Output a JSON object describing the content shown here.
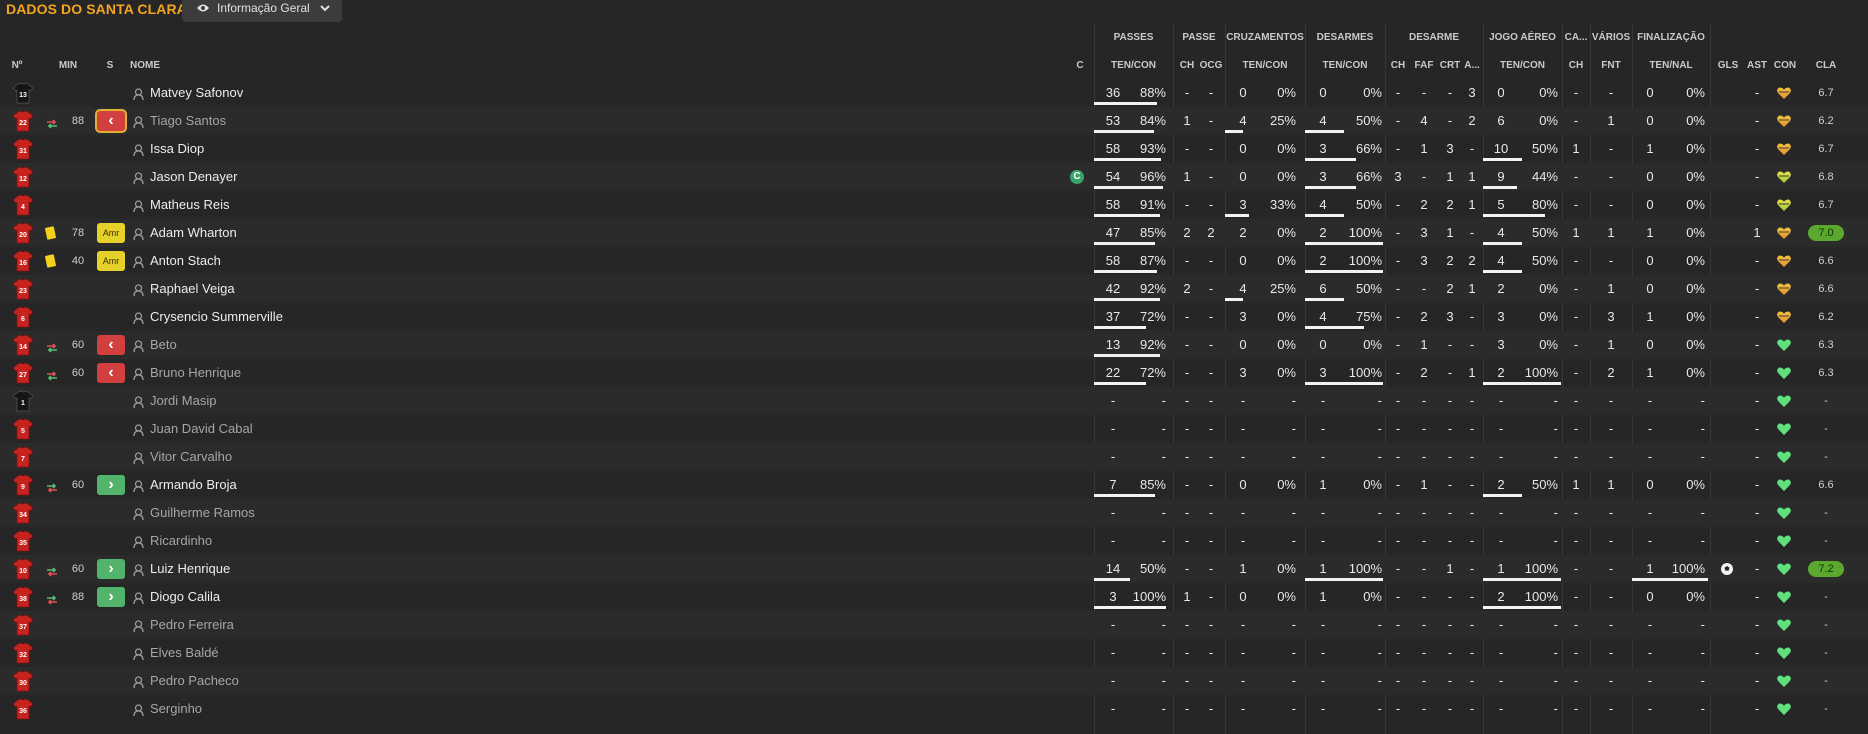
{
  "header": {
    "title": "DADOS DO SANTA CLARA",
    "view_label": "Informação Geral"
  },
  "groups": {
    "passes": "PASSES",
    "passe": "PASSE",
    "cruzamentos": "CRUZAMENTOS",
    "desarmes": "DESARMES",
    "desarme": "DESARME",
    "jogo_aereo": "JOGO AÉREO",
    "ca": "CA...",
    "varios": "VÁRIOS",
    "finalizacao": "FINALIZAÇÃO"
  },
  "columns": {
    "num": "Nº",
    "min": "MIN",
    "s": "S",
    "nome": "NOME",
    "c": "C",
    "passes_tc": "TEN/CON",
    "passe_ch": "CH",
    "passe_ocg": "OCG",
    "cruz_tc": "TEN/CON",
    "desarmes_tc": "TEN/CON",
    "des_ch": "CH",
    "des_faf": "FAF",
    "des_crt": "CRT",
    "des_a": "A...",
    "aereo_tc": "TEN/CON",
    "ca_ch": "CH",
    "var_fnt": "FNT",
    "fin_tn": "TEN/NAL",
    "gls": "GLS",
    "ast": "AST",
    "con": "CON",
    "cla": "CLA"
  },
  "colors": {
    "accent": "#f2a51f",
    "sub_out": "#d23f3f",
    "sub_in": "#52b36b",
    "yellow_card": "#f3d21e",
    "best_rating": "#5aa82e"
  },
  "players": [
    {
      "num": "13",
      "kit": "gk",
      "name": "Matvey Safonov",
      "dim": false,
      "event": "",
      "min": "",
      "badge": "",
      "captain": false,
      "pa_ten": "36",
      "pa_pct": "88%",
      "pa_fill": 0.88,
      "ps_ch": "-",
      "ps_ocg": "-",
      "cr_ten": "0",
      "cr_pct": "0%",
      "cr_fill": 0,
      "de_ten": "0",
      "de_pct": "0%",
      "de_fill": 0,
      "d_ch": "-",
      "d_faf": "-",
      "d_crt": "-",
      "d_a": "3",
      "ae_ten": "0",
      "ae_pct": "0%",
      "ae_fill": 0,
      "ca_ch": "-",
      "v_fnt": "-",
      "fi_ten": "0",
      "fi_pct": "0%",
      "fi_fill": 0,
      "gls": "",
      "ast": "-",
      "con": "orange",
      "cla": "6.7",
      "best": false
    },
    {
      "num": "22",
      "kit": "red",
      "name": "Tiago Santos",
      "dim": true,
      "event": "out",
      "min": "88",
      "badge": "out-hl",
      "captain": false,
      "pa_ten": "53",
      "pa_pct": "84%",
      "pa_fill": 0.84,
      "ps_ch": "1",
      "ps_ocg": "-",
      "cr_ten": "4",
      "cr_pct": "25%",
      "cr_fill": 0.25,
      "de_ten": "4",
      "de_pct": "50%",
      "de_fill": 0.5,
      "d_ch": "-",
      "d_faf": "4",
      "d_crt": "-",
      "d_a": "2",
      "ae_ten": "6",
      "ae_pct": "0%",
      "ae_fill": 0,
      "ca_ch": "-",
      "v_fnt": "1",
      "fi_ten": "0",
      "fi_pct": "0%",
      "fi_fill": 0,
      "gls": "",
      "ast": "-",
      "con": "orange",
      "cla": "6.2",
      "best": false
    },
    {
      "num": "31",
      "kit": "red",
      "name": "Issa Diop",
      "dim": false,
      "event": "",
      "min": "",
      "badge": "",
      "captain": false,
      "pa_ten": "58",
      "pa_pct": "93%",
      "pa_fill": 0.93,
      "ps_ch": "-",
      "ps_ocg": "-",
      "cr_ten": "0",
      "cr_pct": "0%",
      "cr_fill": 0,
      "de_ten": "3",
      "de_pct": "66%",
      "de_fill": 0.66,
      "d_ch": "-",
      "d_faf": "1",
      "d_crt": "3",
      "d_a": "-",
      "ae_ten": "10",
      "ae_pct": "50%",
      "ae_fill": 0.5,
      "ca_ch": "1",
      "v_fnt": "-",
      "fi_ten": "1",
      "fi_pct": "0%",
      "fi_fill": 0,
      "gls": "",
      "ast": "-",
      "con": "orange",
      "cla": "6.7",
      "best": false
    },
    {
      "num": "12",
      "kit": "red",
      "name": "Jason Denayer",
      "dim": false,
      "event": "",
      "min": "",
      "badge": "",
      "captain": true,
      "pa_ten": "54",
      "pa_pct": "96%",
      "pa_fill": 0.96,
      "ps_ch": "1",
      "ps_ocg": "-",
      "cr_ten": "0",
      "cr_pct": "0%",
      "cr_fill": 0,
      "de_ten": "3",
      "de_pct": "66%",
      "de_fill": 0.66,
      "d_ch": "3",
      "d_faf": "-",
      "d_crt": "1",
      "d_a": "1",
      "ae_ten": "9",
      "ae_pct": "44%",
      "ae_fill": 0.44,
      "ca_ch": "-",
      "v_fnt": "-",
      "fi_ten": "0",
      "fi_pct": "0%",
      "fi_fill": 0,
      "gls": "",
      "ast": "-",
      "con": "yellow",
      "cla": "6.8",
      "best": false
    },
    {
      "num": "4",
      "kit": "red",
      "name": "Matheus Reis",
      "dim": false,
      "event": "",
      "min": "",
      "badge": "",
      "captain": false,
      "pa_ten": "58",
      "pa_pct": "91%",
      "pa_fill": 0.91,
      "ps_ch": "-",
      "ps_ocg": "-",
      "cr_ten": "3",
      "cr_pct": "33%",
      "cr_fill": 0.33,
      "de_ten": "4",
      "de_pct": "50%",
      "de_fill": 0.5,
      "d_ch": "-",
      "d_faf": "2",
      "d_crt": "2",
      "d_a": "1",
      "ae_ten": "5",
      "ae_pct": "80%",
      "ae_fill": 0.8,
      "ca_ch": "-",
      "v_fnt": "-",
      "fi_ten": "0",
      "fi_pct": "0%",
      "fi_fill": 0,
      "gls": "",
      "ast": "-",
      "con": "yellow",
      "cla": "6.7",
      "best": false
    },
    {
      "num": "20",
      "kit": "red",
      "name": "Adam Wharton",
      "dim": false,
      "event": "yellow",
      "min": "78",
      "badge": "amr",
      "captain": false,
      "pa_ten": "47",
      "pa_pct": "85%",
      "pa_fill": 0.85,
      "ps_ch": "2",
      "ps_ocg": "2",
      "cr_ten": "2",
      "cr_pct": "0%",
      "cr_fill": 0,
      "de_ten": "2",
      "de_pct": "100%",
      "de_fill": 1,
      "d_ch": "-",
      "d_faf": "3",
      "d_crt": "1",
      "d_a": "-",
      "ae_ten": "4",
      "ae_pct": "50%",
      "ae_fill": 0.5,
      "ca_ch": "1",
      "v_fnt": "1",
      "fi_ten": "1",
      "fi_pct": "0%",
      "fi_fill": 0,
      "gls": "",
      "ast": "1",
      "con": "orange",
      "cla": "7.0",
      "best": true
    },
    {
      "num": "16",
      "kit": "red",
      "name": "Anton Stach",
      "dim": false,
      "event": "yellow",
      "min": "40",
      "badge": "amr",
      "captain": false,
      "pa_ten": "58",
      "pa_pct": "87%",
      "pa_fill": 0.87,
      "ps_ch": "-",
      "ps_ocg": "-",
      "cr_ten": "0",
      "cr_pct": "0%",
      "cr_fill": 0,
      "de_ten": "2",
      "de_pct": "100%",
      "de_fill": 1,
      "d_ch": "-",
      "d_faf": "3",
      "d_crt": "2",
      "d_a": "2",
      "ae_ten": "4",
      "ae_pct": "50%",
      "ae_fill": 0.5,
      "ca_ch": "-",
      "v_fnt": "-",
      "fi_ten": "0",
      "fi_pct": "0%",
      "fi_fill": 0,
      "gls": "",
      "ast": "-",
      "con": "orange",
      "cla": "6.6",
      "best": false
    },
    {
      "num": "23",
      "kit": "red",
      "name": "Raphael Veiga",
      "dim": false,
      "event": "",
      "min": "",
      "badge": "",
      "captain": false,
      "pa_ten": "42",
      "pa_pct": "92%",
      "pa_fill": 0.92,
      "ps_ch": "2",
      "ps_ocg": "-",
      "cr_ten": "4",
      "cr_pct": "25%",
      "cr_fill": 0.25,
      "de_ten": "6",
      "de_pct": "50%",
      "de_fill": 0.5,
      "d_ch": "-",
      "d_faf": "-",
      "d_crt": "2",
      "d_a": "1",
      "ae_ten": "2",
      "ae_pct": "0%",
      "ae_fill": 0,
      "ca_ch": "-",
      "v_fnt": "1",
      "fi_ten": "0",
      "fi_pct": "0%",
      "fi_fill": 0,
      "gls": "",
      "ast": "-",
      "con": "orange",
      "cla": "6.6",
      "best": false
    },
    {
      "num": "6",
      "kit": "red",
      "name": "Crysencio Summerville",
      "dim": false,
      "event": "",
      "min": "",
      "badge": "",
      "captain": false,
      "pa_ten": "37",
      "pa_pct": "72%",
      "pa_fill": 0.72,
      "ps_ch": "-",
      "ps_ocg": "-",
      "cr_ten": "3",
      "cr_pct": "0%",
      "cr_fill": 0,
      "de_ten": "4",
      "de_pct": "75%",
      "de_fill": 0.75,
      "d_ch": "-",
      "d_faf": "2",
      "d_crt": "3",
      "d_a": "-",
      "ae_ten": "3",
      "ae_pct": "0%",
      "ae_fill": 0,
      "ca_ch": "-",
      "v_fnt": "3",
      "fi_ten": "1",
      "fi_pct": "0%",
      "fi_fill": 0,
      "gls": "",
      "ast": "-",
      "con": "orange",
      "cla": "6.2",
      "best": false
    },
    {
      "num": "14",
      "kit": "red",
      "name": "Beto",
      "dim": true,
      "event": "out",
      "min": "60",
      "badge": "out",
      "captain": false,
      "pa_ten": "13",
      "pa_pct": "92%",
      "pa_fill": 0.92,
      "ps_ch": "-",
      "ps_ocg": "-",
      "cr_ten": "0",
      "cr_pct": "0%",
      "cr_fill": 0,
      "de_ten": "0",
      "de_pct": "0%",
      "de_fill": 0,
      "d_ch": "-",
      "d_faf": "1",
      "d_crt": "-",
      "d_a": "-",
      "ae_ten": "3",
      "ae_pct": "0%",
      "ae_fill": 0,
      "ca_ch": "-",
      "v_fnt": "1",
      "fi_ten": "0",
      "fi_pct": "0%",
      "fi_fill": 0,
      "gls": "",
      "ast": "-",
      "con": "green",
      "cla": "6.3",
      "best": false
    },
    {
      "num": "27",
      "kit": "red",
      "name": "Bruno Henrique",
      "dim": true,
      "event": "out",
      "min": "60",
      "badge": "out",
      "captain": false,
      "pa_ten": "22",
      "pa_pct": "72%",
      "pa_fill": 0.72,
      "ps_ch": "-",
      "ps_ocg": "-",
      "cr_ten": "3",
      "cr_pct": "0%",
      "cr_fill": 0,
      "de_ten": "3",
      "de_pct": "100%",
      "de_fill": 1,
      "d_ch": "-",
      "d_faf": "2",
      "d_crt": "-",
      "d_a": "1",
      "ae_ten": "2",
      "ae_pct": "100%",
      "ae_fill": 1,
      "ca_ch": "-",
      "v_fnt": "2",
      "fi_ten": "1",
      "fi_pct": "0%",
      "fi_fill": 0,
      "gls": "",
      "ast": "-",
      "con": "green",
      "cla": "6.3",
      "best": false
    },
    {
      "num": "1",
      "kit": "gk",
      "name": "Jordi Masip",
      "dim": true,
      "event": "",
      "min": "",
      "badge": "",
      "captain": false,
      "pa_ten": "-",
      "pa_pct": "-",
      "pa_fill": 0,
      "ps_ch": "-",
      "ps_ocg": "-",
      "cr_ten": "-",
      "cr_pct": "-",
      "cr_fill": 0,
      "de_ten": "-",
      "de_pct": "-",
      "de_fill": 0,
      "d_ch": "-",
      "d_faf": "-",
      "d_crt": "-",
      "d_a": "-",
      "ae_ten": "-",
      "ae_pct": "-",
      "ae_fill": 0,
      "ca_ch": "-",
      "v_fnt": "-",
      "fi_ten": "-",
      "fi_pct": "-",
      "fi_fill": 0,
      "gls": "",
      "ast": "-",
      "con": "green",
      "cla": "-",
      "best": false
    },
    {
      "num": "5",
      "kit": "red",
      "name": "Juan David Cabal",
      "dim": true,
      "event": "",
      "min": "",
      "badge": "",
      "captain": false,
      "pa_ten": "-",
      "pa_pct": "-",
      "pa_fill": 0,
      "ps_ch": "-",
      "ps_ocg": "-",
      "cr_ten": "-",
      "cr_pct": "-",
      "cr_fill": 0,
      "de_ten": "-",
      "de_pct": "-",
      "de_fill": 0,
      "d_ch": "-",
      "d_faf": "-",
      "d_crt": "-",
      "d_a": "-",
      "ae_ten": "-",
      "ae_pct": "-",
      "ae_fill": 0,
      "ca_ch": "-",
      "v_fnt": "-",
      "fi_ten": "-",
      "fi_pct": "-",
      "fi_fill": 0,
      "gls": "",
      "ast": "-",
      "con": "green",
      "cla": "-",
      "best": false
    },
    {
      "num": "7",
      "kit": "red",
      "name": "Vitor Carvalho",
      "dim": true,
      "event": "",
      "min": "",
      "badge": "",
      "captain": false,
      "pa_ten": "-",
      "pa_pct": "-",
      "pa_fill": 0,
      "ps_ch": "-",
      "ps_ocg": "-",
      "cr_ten": "-",
      "cr_pct": "-",
      "cr_fill": 0,
      "de_ten": "-",
      "de_pct": "-",
      "de_fill": 0,
      "d_ch": "-",
      "d_faf": "-",
      "d_crt": "-",
      "d_a": "-",
      "ae_ten": "-",
      "ae_pct": "-",
      "ae_fill": 0,
      "ca_ch": "-",
      "v_fnt": "-",
      "fi_ten": "-",
      "fi_pct": "-",
      "fi_fill": 0,
      "gls": "",
      "ast": "-",
      "con": "green",
      "cla": "-",
      "best": false
    },
    {
      "num": "9",
      "kit": "red",
      "name": "Armando Broja",
      "dim": false,
      "event": "in",
      "min": "60",
      "badge": "in",
      "captain": false,
      "pa_ten": "7",
      "pa_pct": "85%",
      "pa_fill": 0.85,
      "ps_ch": "-",
      "ps_ocg": "-",
      "cr_ten": "0",
      "cr_pct": "0%",
      "cr_fill": 0,
      "de_ten": "1",
      "de_pct": "0%",
      "de_fill": 0,
      "d_ch": "-",
      "d_faf": "1",
      "d_crt": "-",
      "d_a": "-",
      "ae_ten": "2",
      "ae_pct": "50%",
      "ae_fill": 0.5,
      "ca_ch": "1",
      "v_fnt": "1",
      "fi_ten": "0",
      "fi_pct": "0%",
      "fi_fill": 0,
      "gls": "",
      "ast": "-",
      "con": "green",
      "cla": "6.6",
      "best": false
    },
    {
      "num": "34",
      "kit": "red",
      "name": "Guilherme Ramos",
      "dim": true,
      "event": "",
      "min": "",
      "badge": "",
      "captain": false,
      "pa_ten": "-",
      "pa_pct": "-",
      "pa_fill": 0,
      "ps_ch": "-",
      "ps_ocg": "-",
      "cr_ten": "-",
      "cr_pct": "-",
      "cr_fill": 0,
      "de_ten": "-",
      "de_pct": "-",
      "de_fill": 0,
      "d_ch": "-",
      "d_faf": "-",
      "d_crt": "-",
      "d_a": "-",
      "ae_ten": "-",
      "ae_pct": "-",
      "ae_fill": 0,
      "ca_ch": "-",
      "v_fnt": "-",
      "fi_ten": "-",
      "fi_pct": "-",
      "fi_fill": 0,
      "gls": "",
      "ast": "-",
      "con": "green",
      "cla": "-",
      "best": false
    },
    {
      "num": "35",
      "kit": "red",
      "name": "Ricardinho",
      "dim": true,
      "event": "",
      "min": "",
      "badge": "",
      "captain": false,
      "pa_ten": "-",
      "pa_pct": "-",
      "pa_fill": 0,
      "ps_ch": "-",
      "ps_ocg": "-",
      "cr_ten": "-",
      "cr_pct": "-",
      "cr_fill": 0,
      "de_ten": "-",
      "de_pct": "-",
      "de_fill": 0,
      "d_ch": "-",
      "d_faf": "-",
      "d_crt": "-",
      "d_a": "-",
      "ae_ten": "-",
      "ae_pct": "-",
      "ae_fill": 0,
      "ca_ch": "-",
      "v_fnt": "-",
      "fi_ten": "-",
      "fi_pct": "-",
      "fi_fill": 0,
      "gls": "",
      "ast": "-",
      "con": "green",
      "cla": "-",
      "best": false
    },
    {
      "num": "10",
      "kit": "red",
      "name": "Luiz Henrique",
      "dim": false,
      "event": "in",
      "min": "60",
      "badge": "in",
      "captain": false,
      "pa_ten": "14",
      "pa_pct": "50%",
      "pa_fill": 0.5,
      "ps_ch": "-",
      "ps_ocg": "-",
      "cr_ten": "1",
      "cr_pct": "0%",
      "cr_fill": 0,
      "de_ten": "1",
      "de_pct": "100%",
      "de_fill": 1,
      "d_ch": "-",
      "d_faf": "-",
      "d_crt": "1",
      "d_a": "-",
      "ae_ten": "1",
      "ae_pct": "100%",
      "ae_fill": 1,
      "ca_ch": "-",
      "v_fnt": "-",
      "fi_ten": "1",
      "fi_pct": "100%",
      "fi_fill": 1,
      "gls": "ball",
      "ast": "-",
      "con": "green",
      "cla": "7.2",
      "best": true
    },
    {
      "num": "38",
      "kit": "red",
      "name": "Diogo Calila",
      "dim": false,
      "event": "in",
      "min": "88",
      "badge": "in",
      "captain": false,
      "pa_ten": "3",
      "pa_pct": "100%",
      "pa_fill": 1,
      "ps_ch": "1",
      "ps_ocg": "-",
      "cr_ten": "0",
      "cr_pct": "0%",
      "cr_fill": 0,
      "de_ten": "1",
      "de_pct": "0%",
      "de_fill": 0,
      "d_ch": "-",
      "d_faf": "-",
      "d_crt": "-",
      "d_a": "-",
      "ae_ten": "2",
      "ae_pct": "100%",
      "ae_fill": 1,
      "ca_ch": "-",
      "v_fnt": "-",
      "fi_ten": "0",
      "fi_pct": "0%",
      "fi_fill": 0,
      "gls": "",
      "ast": "-",
      "con": "green",
      "cla": "-",
      "best": false
    },
    {
      "num": "37",
      "kit": "red",
      "name": "Pedro Ferreira",
      "dim": true,
      "event": "",
      "min": "",
      "badge": "",
      "captain": false,
      "pa_ten": "-",
      "pa_pct": "-",
      "pa_fill": 0,
      "ps_ch": "-",
      "ps_ocg": "-",
      "cr_ten": "-",
      "cr_pct": "-",
      "cr_fill": 0,
      "de_ten": "-",
      "de_pct": "-",
      "de_fill": 0,
      "d_ch": "-",
      "d_faf": "-",
      "d_crt": "-",
      "d_a": "-",
      "ae_ten": "-",
      "ae_pct": "-",
      "ae_fill": 0,
      "ca_ch": "-",
      "v_fnt": "-",
      "fi_ten": "-",
      "fi_pct": "-",
      "fi_fill": 0,
      "gls": "",
      "ast": "-",
      "con": "green",
      "cla": "-",
      "best": false
    },
    {
      "num": "32",
      "kit": "red",
      "name": "Elves Baldé",
      "dim": true,
      "event": "",
      "min": "",
      "badge": "",
      "captain": false,
      "pa_ten": "-",
      "pa_pct": "-",
      "pa_fill": 0,
      "ps_ch": "-",
      "ps_ocg": "-",
      "cr_ten": "-",
      "cr_pct": "-",
      "cr_fill": 0,
      "de_ten": "-",
      "de_pct": "-",
      "de_fill": 0,
      "d_ch": "-",
      "d_faf": "-",
      "d_crt": "-",
      "d_a": "-",
      "ae_ten": "-",
      "ae_pct": "-",
      "ae_fill": 0,
      "ca_ch": "-",
      "v_fnt": "-",
      "fi_ten": "-",
      "fi_pct": "-",
      "fi_fill": 0,
      "gls": "",
      "ast": "-",
      "con": "green",
      "cla": "-",
      "best": false
    },
    {
      "num": "30",
      "kit": "red",
      "name": "Pedro Pacheco",
      "dim": true,
      "event": "",
      "min": "",
      "badge": "",
      "captain": false,
      "pa_ten": "-",
      "pa_pct": "-",
      "pa_fill": 0,
      "ps_ch": "-",
      "ps_ocg": "-",
      "cr_ten": "-",
      "cr_pct": "-",
      "cr_fill": 0,
      "de_ten": "-",
      "de_pct": "-",
      "de_fill": 0,
      "d_ch": "-",
      "d_faf": "-",
      "d_crt": "-",
      "d_a": "-",
      "ae_ten": "-",
      "ae_pct": "-",
      "ae_fill": 0,
      "ca_ch": "-",
      "v_fnt": "-",
      "fi_ten": "-",
      "fi_pct": "-",
      "fi_fill": 0,
      "gls": "",
      "ast": "-",
      "con": "green",
      "cla": "-",
      "best": false
    },
    {
      "num": "36",
      "kit": "red",
      "name": "Serginho",
      "dim": true,
      "event": "",
      "min": "",
      "badge": "",
      "captain": false,
      "pa_ten": "-",
      "pa_pct": "-",
      "pa_fill": 0,
      "ps_ch": "-",
      "ps_ocg": "-",
      "cr_ten": "-",
      "cr_pct": "-",
      "cr_fill": 0,
      "de_ten": "-",
      "de_pct": "-",
      "de_fill": 0,
      "d_ch": "-",
      "d_faf": "-",
      "d_crt": "-",
      "d_a": "-",
      "ae_ten": "-",
      "ae_pct": "-",
      "ae_fill": 0,
      "ca_ch": "-",
      "v_fnt": "-",
      "fi_ten": "-",
      "fi_pct": "-",
      "fi_fill": 0,
      "gls": "",
      "ast": "-",
      "con": "green",
      "cla": "-",
      "best": false
    }
  ]
}
